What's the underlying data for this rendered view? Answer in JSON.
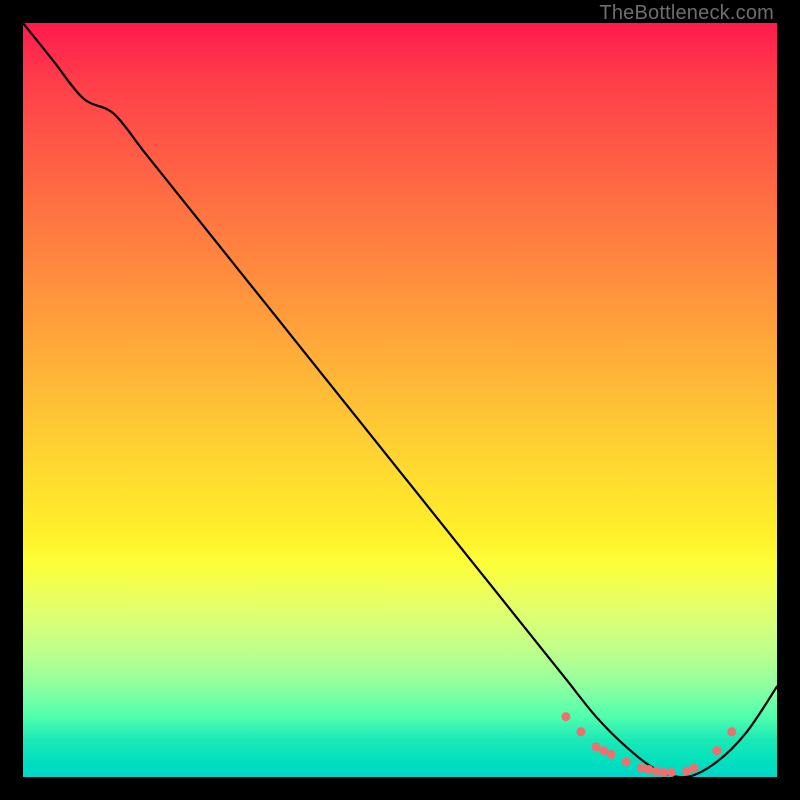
{
  "credit": "TheBottleneck.com",
  "chart_data": {
    "type": "line",
    "title": "",
    "xlabel": "",
    "ylabel": "",
    "xlim": [
      0,
      100
    ],
    "ylim": [
      0,
      100
    ],
    "series": [
      {
        "name": "bottleneck-curve",
        "x": [
          0,
          4,
          8,
          12,
          16,
          20,
          24,
          28,
          32,
          36,
          40,
          44,
          48,
          52,
          56,
          60,
          64,
          68,
          72,
          76,
          80,
          84,
          88,
          92,
          96,
          100
        ],
        "y": [
          100,
          95,
          90,
          88,
          83,
          78,
          73,
          68,
          63,
          58,
          53,
          48,
          43,
          38,
          33,
          28,
          23,
          18,
          13,
          8,
          4,
          1,
          0,
          2,
          6,
          12
        ]
      }
    ],
    "markers": {
      "name": "highlighted-points",
      "x": [
        72,
        74,
        76,
        77,
        78,
        80,
        82,
        83,
        84,
        85,
        86,
        88,
        89,
        92,
        94
      ],
      "y": [
        8,
        6,
        4,
        3.5,
        3,
        2,
        1.2,
        1,
        0.8,
        0.6,
        0.6,
        0.8,
        1.2,
        3.5,
        6
      ],
      "color": "#ef6f6f",
      "size": 9
    },
    "gradient_stops": [
      {
        "pos": 0,
        "color": "#ff1a4d"
      },
      {
        "pos": 22,
        "color": "#ff6a43"
      },
      {
        "pos": 46,
        "color": "#ffb338"
      },
      {
        "pos": 68,
        "color": "#fff12a"
      },
      {
        "pos": 88,
        "color": "#8effa0"
      },
      {
        "pos": 100,
        "color": "#00d5c8"
      }
    ]
  }
}
